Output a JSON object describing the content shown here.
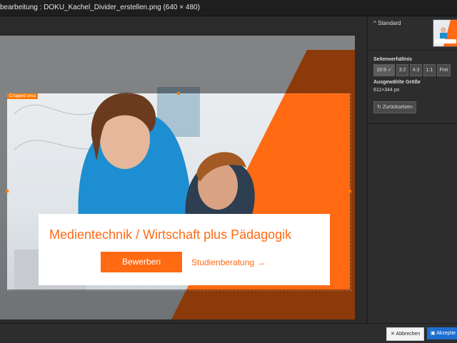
{
  "window": {
    "title": "bearbeitung : DOKU_Kachel_Divider_erstellen.png (640 × 480)"
  },
  "crop": {
    "label": "Cropped area"
  },
  "banner": {
    "title": "Medientechnik / Wirtschaft plus Pädagogik",
    "apply_label": "Bewerben",
    "advice_label": "Studienberatung →"
  },
  "sidebar": {
    "preset_label": "Standard",
    "ratio_heading": "Seitenverhältnis",
    "ratios": [
      {
        "label": "16:9 ✓"
      },
      {
        "label": "3:2"
      },
      {
        "label": "4:3"
      },
      {
        "label": "1:1"
      },
      {
        "label": "Frei"
      }
    ],
    "size_heading": "Ausgewählte Größe",
    "size_value": "611×344 px",
    "reset_label": "Zurücksetzen"
  },
  "footer": {
    "cancel_label": "✕ Abbrechen",
    "accept_label": "Akzeptie"
  },
  "icons": {
    "collapse": "chevron-up-icon",
    "reset": "refresh-icon",
    "save": "save-icon",
    "cancel": "close-icon"
  },
  "colors": {
    "brand_orange": "#ff6a13",
    "accept_blue": "#1f6fd1"
  }
}
